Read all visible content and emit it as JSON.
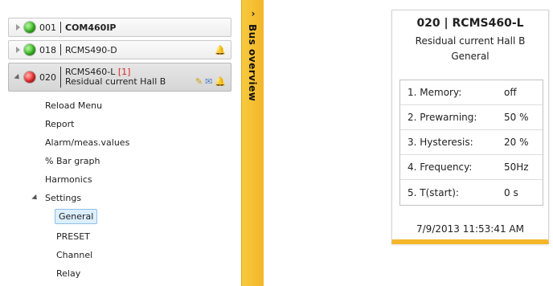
{
  "devices": [
    {
      "address": "001",
      "name": "COM460IP",
      "status_color": "#3fc127"
    },
    {
      "address": "018",
      "name": "RCMS490-D",
      "status_color": "#3fc127"
    },
    {
      "address": "020",
      "name": "RCMS460-L",
      "alarm_index": "[1]",
      "description": "Residual current Hall B",
      "status_color": "#f23030"
    }
  ],
  "menu": {
    "items": [
      "Reload Menu",
      "Report",
      "Alarm/meas.values",
      "% Bar graph",
      "Harmonics"
    ],
    "settings_label": "Settings",
    "settings_items": [
      "General",
      "PRESET",
      "Channel",
      "Relay"
    ],
    "selected_item": "General"
  },
  "bus_overview": {
    "label": "Bus overview",
    "chevron": "›"
  },
  "detail": {
    "title": "020 | RCMS460-L",
    "subtitle": "Residual current Hall B",
    "section": "General",
    "params": [
      {
        "label": "1. Memory:",
        "value": "off"
      },
      {
        "label": "2. Prewarning:",
        "value": "50 %"
      },
      {
        "label": "3. Hysteresis:",
        "value": "20 %"
      },
      {
        "label": "4. Frequency:",
        "value": "50Hz"
      },
      {
        "label": "5. T(start):",
        "value": "0 s"
      }
    ],
    "timestamp": "7/9/2013 11:53:41 AM"
  },
  "colors": {
    "accent": "#f4b62a",
    "alarm_text": "#e02020",
    "selection_bg": "#dcefff"
  }
}
